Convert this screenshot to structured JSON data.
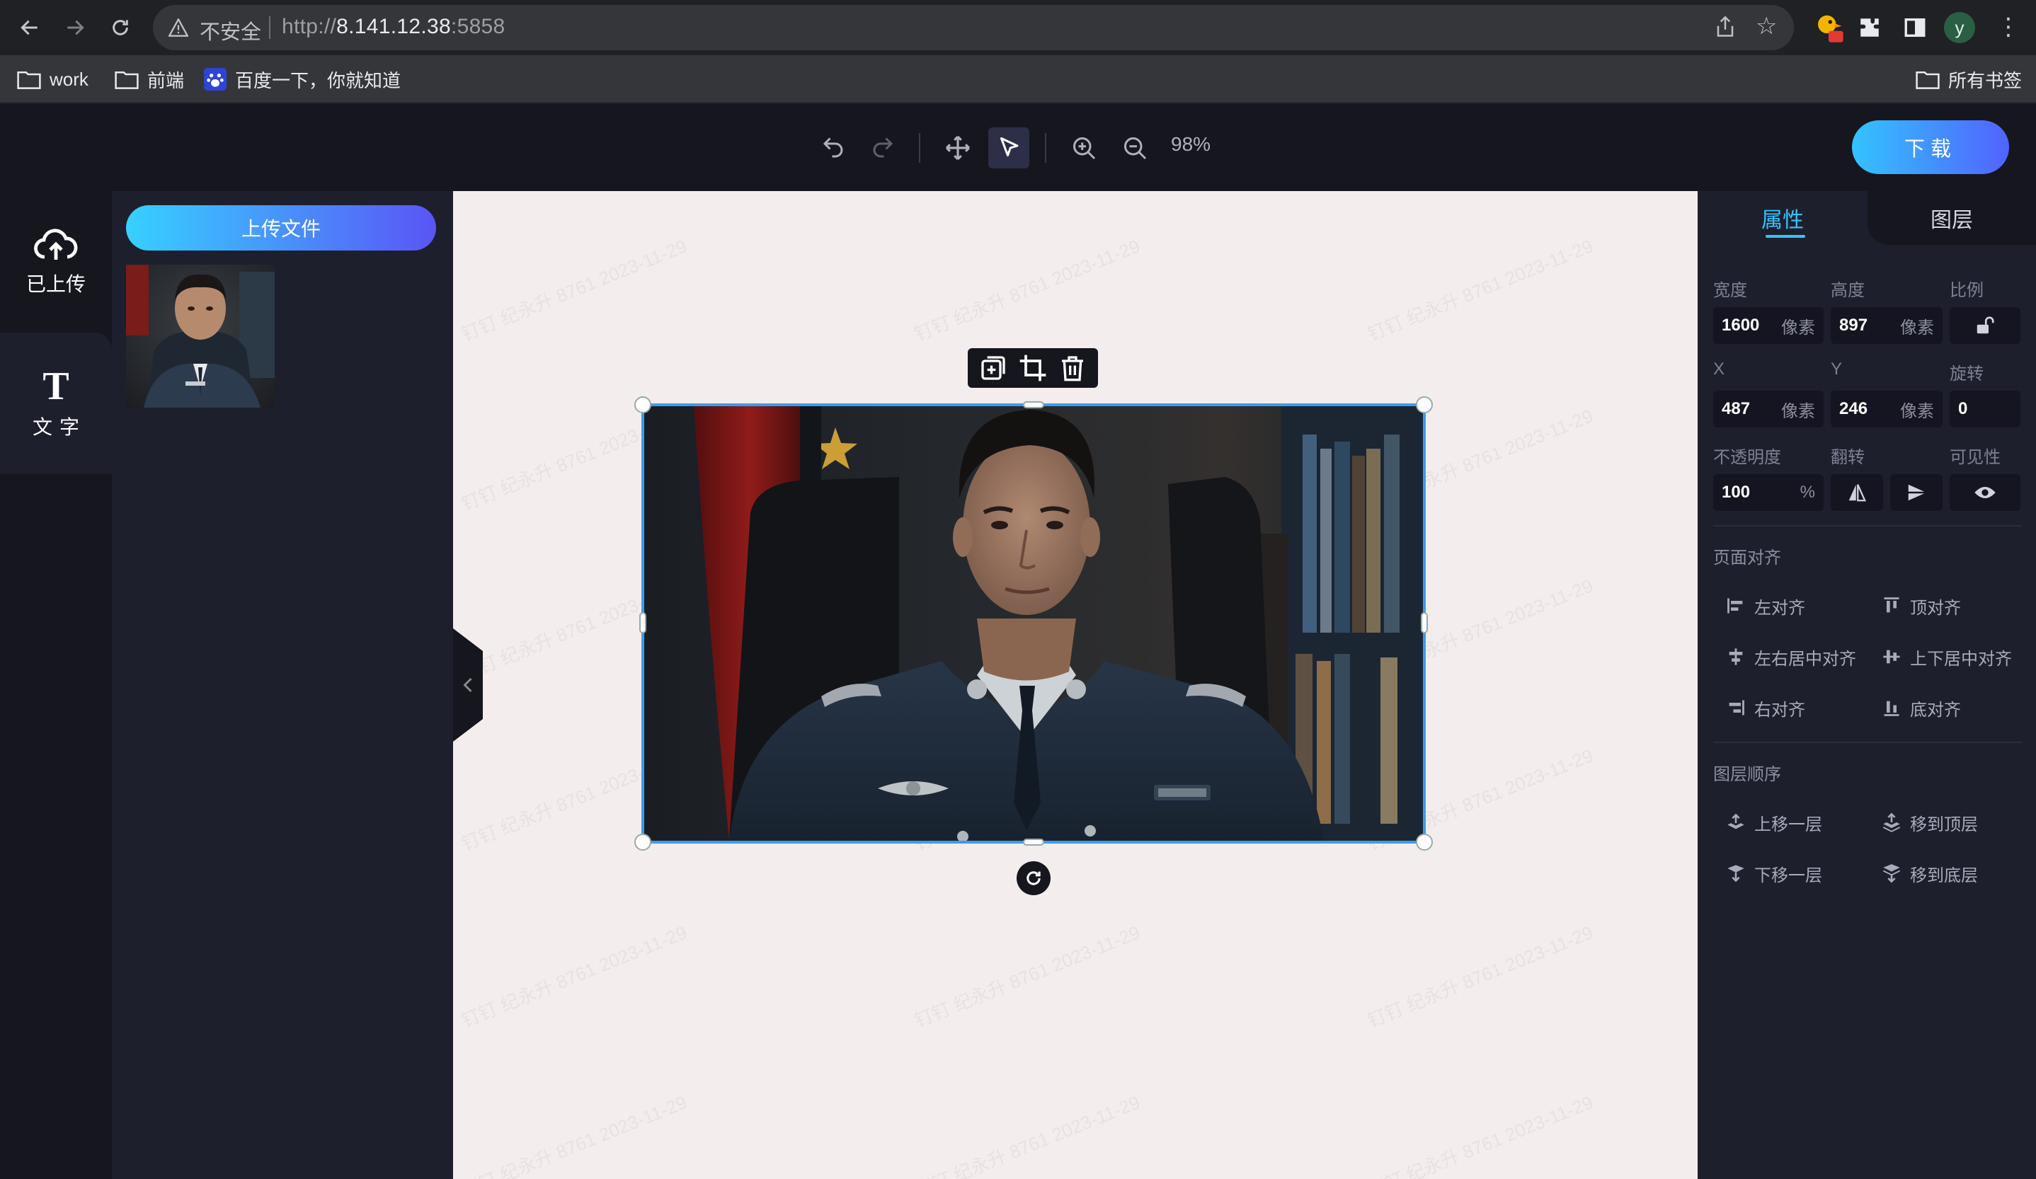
{
  "browser": {
    "insecure_label": "不安全",
    "url_prefix": "http://",
    "url_host": "8.141.12.38",
    "url_port": ":5858",
    "avatar_letter": "y",
    "bookmarks": [
      {
        "label": "work"
      },
      {
        "label": "前端"
      },
      {
        "label": "百度一下，你就知道"
      }
    ],
    "all_bookmarks_label": "所有书签"
  },
  "toolbar": {
    "zoom_level": "98%",
    "download_label": "下载"
  },
  "left_rail": {
    "uploaded_label": "已上传",
    "text_tool_label": "文字",
    "text_tool_glyph": "T"
  },
  "upload_panel": {
    "upload_button_label": "上传文件"
  },
  "canvas": {
    "watermark_text": "钉钉 纪永升 8761 2023-11-29"
  },
  "properties": {
    "tab_properties": "属性",
    "tab_layers": "图层",
    "width_label": "宽度",
    "width_value": "1600",
    "height_label": "高度",
    "height_value": "897",
    "ratio_label": "比例",
    "x_label": "X",
    "x_value": "487",
    "y_label": "Y",
    "y_value": "246",
    "rotate_label": "旋转",
    "rotate_value": "0",
    "unit_px": "像素",
    "opacity_label": "不透明度",
    "opacity_value": "100",
    "opacity_unit": "%",
    "flip_label": "翻转",
    "visibility_label": "可见性",
    "page_align_title": "页面对齐",
    "align_left": "左对齐",
    "align_top": "顶对齐",
    "align_h_center": "左右居中对齐",
    "align_v_center": "上下居中对齐",
    "align_right": "右对齐",
    "align_bottom": "底对齐",
    "layer_order_title": "图层顺序",
    "layer_up": "上移一层",
    "layer_to_top": "移到顶层",
    "layer_down": "下移一层",
    "layer_to_bottom": "移到底层"
  },
  "colors": {
    "accent": "#33c5ff",
    "selection": "#3a9cf0",
    "canvas_bg": "#f4eded",
    "panel_bg": "#1e1f2d"
  }
}
